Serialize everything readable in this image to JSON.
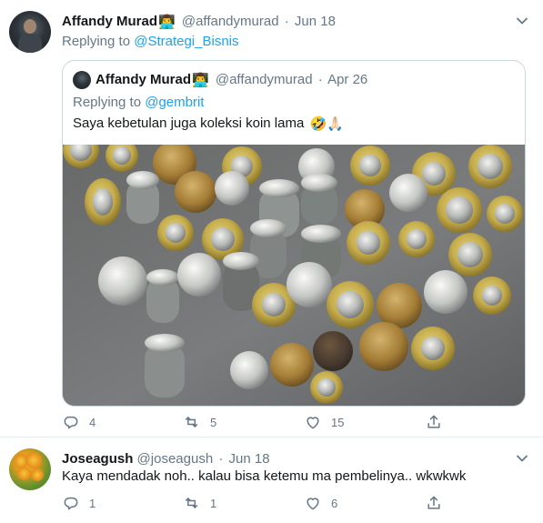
{
  "main_tweet": {
    "display_name": "Affandy Murad",
    "user_emoji": "👨‍💻",
    "handle": "@affandymurad",
    "separator": "·",
    "date": "Jun 18",
    "replying_label": "Replying to",
    "replying_mention": "@Strategi_Bisnis",
    "quote": {
      "display_name": "Affandy Murad",
      "user_emoji": "👨‍💻",
      "handle": "@affandymurad",
      "separator": "·",
      "date": "Apr 26",
      "replying_label": "Replying to",
      "replying_mention": "@gembrit",
      "text": "Saya kebetulan juga koleksi koin lama",
      "text_emojis": "🤣🙏🏻"
    },
    "actions": {
      "reply_count": "4",
      "retweet_count": "5",
      "like_count": "15"
    }
  },
  "reply_tweet": {
    "display_name": "Joseagush",
    "handle": "@joseagush",
    "separator": "·",
    "date": "Jun 18",
    "text": "Kaya mendadak noh.. kalau bisa ketemu ma pembelinya.. wkwkwk",
    "actions": {
      "reply_count": "1",
      "retweet_count": "1",
      "like_count": "6"
    }
  },
  "icons": {
    "more": "chevron-down-icon",
    "reply": "reply-icon",
    "retweet": "retweet-icon",
    "like": "heart-icon",
    "share": "share-icon"
  },
  "colors": {
    "link": "#1da1f2",
    "secondary_text": "#657786",
    "border": "#e6ecf0",
    "quote_border": "#ccd6dd"
  }
}
